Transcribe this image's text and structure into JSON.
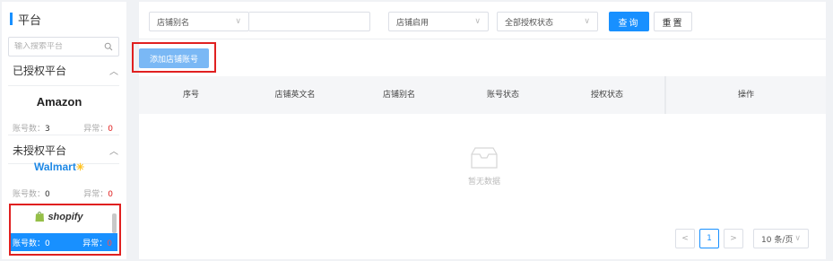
{
  "sidebar": {
    "title": "平台",
    "search_placeholder": "输入搜索平台",
    "authorized_label": "已授权平台",
    "unauthorized_label": "未授权平台",
    "platforms": [
      {
        "name": "Amazon",
        "count_label": "账号数：",
        "count": "3",
        "error_label": "异常：",
        "errors": "0"
      },
      {
        "name": "Walmart",
        "count_label": "账号数：",
        "count": "0",
        "error_label": "异常：",
        "errors": "0"
      },
      {
        "name": "shopify",
        "count_label": "账号数：",
        "count": "0",
        "error_label": "异常：",
        "errors": "0"
      }
    ]
  },
  "filters": {
    "alias_select": "店铺别名",
    "enabled_select": "店铺启用",
    "auth_status_select": "全部授权状态",
    "query_label": "查询",
    "reset_label": "重置"
  },
  "add_button_label": "添加店铺账号",
  "table": {
    "columns": [
      "序号",
      "店铺英文名",
      "店铺别名",
      "账号状态",
      "授权状态",
      "操作"
    ],
    "empty_text": "暂无数据"
  },
  "pagination": {
    "current_page": "1",
    "page_size": "10 条/页"
  },
  "colors": {
    "primary": "#1890ff",
    "error": "#e02020",
    "highlight_box": "#e02020"
  }
}
